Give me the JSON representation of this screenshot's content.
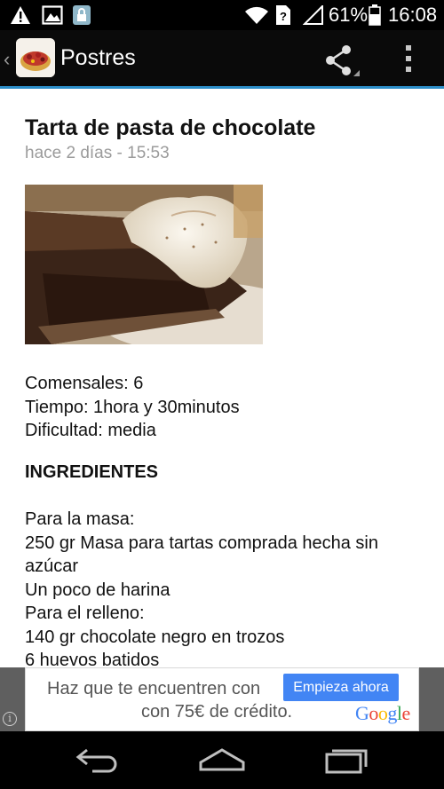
{
  "status_bar": {
    "battery_percent": "61%",
    "time": "16:08",
    "icons": [
      "warning-icon",
      "image-icon",
      "lock-app-icon",
      "wifi-icon",
      "sim-unknown-icon",
      "signal-icon",
      "battery-icon"
    ]
  },
  "action_bar": {
    "title": "Postres",
    "icons": [
      "up-chevron-icon",
      "app-logo-icon",
      "share-icon",
      "overflow-menu-icon"
    ],
    "accent_color": "#2c8ec8"
  },
  "article": {
    "title": "Tarta de pasta de chocolate",
    "date": "hace 2 días - 15:53",
    "meta": [
      "Comensales: 6",
      "Tiempo: 1hora y 30minutos",
      "Dificultad: media"
    ],
    "ingredients_heading": "INGREDIENTES",
    "ingredients": [
      "Para la masa:",
      "250 gr Masa para tartas comprada hecha sin azúcar",
      "Un poco de harina",
      "Para el relleno:",
      "140 gr chocolate negro en trozos",
      "6 huevos batidos"
    ]
  },
  "ad": {
    "line1": "Haz que te encuentren con",
    "line2": "con 75€ de crédito.",
    "cta": "Empieza ahora",
    "brand": "Google",
    "cta_color": "#4285f4"
  },
  "nav_bar": {
    "icons": [
      "back-icon",
      "home-icon",
      "recents-icon"
    ]
  }
}
